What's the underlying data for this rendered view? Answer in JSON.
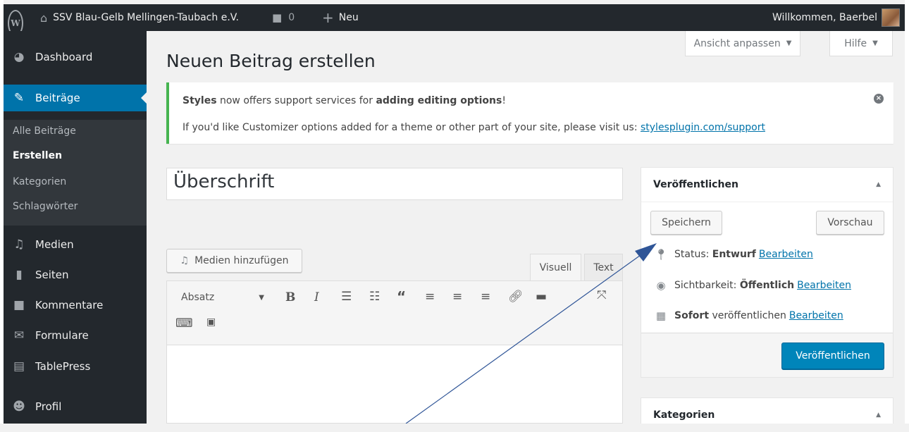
{
  "adminbar": {
    "site_name": "SSV Blau-Gelb Mellingen-Taubach e.V.",
    "comments_count": "0",
    "new_label": "Neu",
    "greeting": "Willkommen, Baerbel"
  },
  "sidebar": {
    "items": [
      {
        "label": "Dashboard",
        "icon": "dashboard-icon"
      },
      {
        "label": "Beiträge",
        "icon": "pin-icon"
      },
      {
        "label": "Medien",
        "icon": "media-icon"
      },
      {
        "label": "Seiten",
        "icon": "pages-icon"
      },
      {
        "label": "Kommentare",
        "icon": "comments-icon"
      },
      {
        "label": "Formulare",
        "icon": "mail-icon"
      },
      {
        "label": "TablePress",
        "icon": "table-icon"
      },
      {
        "label": "Profil",
        "icon": "user-icon"
      }
    ],
    "submenu": [
      "Alle Beiträge",
      "Erstellen",
      "Kategorien",
      "Schlagwörter"
    ]
  },
  "screen_options": {
    "label": "Ansicht anpassen",
    "help": "Hilfe"
  },
  "page_title": "Neuen Beitrag erstellen",
  "notice": {
    "line1_brand": "Styles",
    "line1_mid": " now offers support services for ",
    "line1_bold": "adding editing options",
    "line1_end": "!",
    "line2_text": "If you'd like Customizer options added for a theme or other part of your site, please visit us: ",
    "line2_link": "stylesplugin.com/support"
  },
  "editor": {
    "title_placeholder": "Überschrift",
    "add_media": "Medien hinzufügen",
    "tab_visual": "Visuell",
    "tab_text": "Text",
    "format_select": "Absatz"
  },
  "publish": {
    "heading": "Veröffentlichen",
    "save_draft": "Speichern",
    "preview": "Vorschau",
    "status_label": "Status:",
    "status_value": "Entwurf",
    "visibility_label": "Sichtbarkeit:",
    "visibility_value": "Öffentlich",
    "schedule_bold": "Sofort",
    "schedule_text": "veröffentlichen",
    "edit_link": "Bearbeiten",
    "publish_button": "Veröffentlichen"
  },
  "categories": {
    "heading": "Kategorien"
  },
  "colors": {
    "accent": "#0073aa",
    "publish": "#0085ba",
    "menu_bg": "#23282d",
    "notice": "#46b450"
  }
}
